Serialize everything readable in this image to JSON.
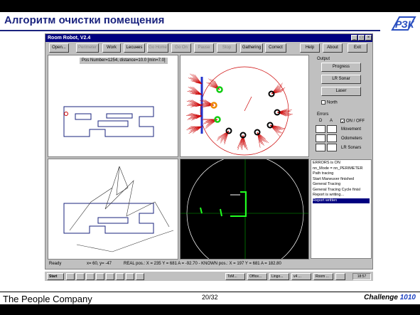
{
  "slide": {
    "title": "Алгоритм очистки помещения",
    "logo": "РЗК",
    "company": "The People Company",
    "page": "20/32",
    "challenge_label": "Challenge",
    "challenge_num": "1010"
  },
  "window": {
    "title": "Room Robot, V2.4",
    "buttons": {
      "open": "Open...",
      "perimeter": "Perimeter",
      "work": "Work",
      "lecture": "Lecuнes",
      "go_home": "Go Home",
      "go_on": "Go On",
      "pause": "Pause",
      "stop": "Stop",
      "gathering": "Gathering",
      "correct": "Correct",
      "help": "Help",
      "about": "About",
      "exit": "Exit"
    },
    "pos_info": "Pos Number=1254, distance=10.0 [min=7.0]",
    "output": {
      "label": "Output",
      "progress": "Progress",
      "lr_sonar": "LR Sonar",
      "laser": "Laser",
      "north": "North"
    },
    "errors": {
      "label": "Errors",
      "col_d": "D",
      "col_a": "A",
      "on_off": "ON / OFF",
      "movement": "Movement",
      "odometers": "Odometers",
      "lr_sonars": "LR Sonars"
    },
    "log": [
      "ERRORS is ON",
      "nn_Mode = nn_PERIMETER",
      "Path tracing",
      "Start Maneuver finished",
      "General Tracing",
      "General Tracing Cycle finisl",
      "Report is writing...",
      "Report written"
    ],
    "status": {
      "ready": "Ready",
      "coords": "x= 60, y= -47",
      "real_pos": "REAL pos.: X = 235 Y = 681 A = -92.70 - KNOWN pos.: X = 197 Y = 681 A = 182.80"
    }
  },
  "taskbar": {
    "start": "Start",
    "tasks": [
      "",
      "",
      "",
      "",
      "",
      "",
      "",
      "",
      "ToM...",
      "Office...",
      "Lingo...",
      "v4 ...",
      "Room ...",
      ""
    ],
    "clock": "18:57"
  }
}
